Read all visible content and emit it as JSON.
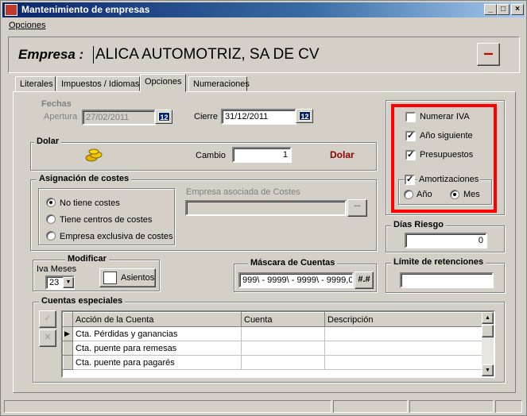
{
  "window": {
    "title": "Mantenimiento de empresas",
    "min": "_",
    "max": "□",
    "close": "×"
  },
  "menu": {
    "opciones": "Opciones"
  },
  "empresa": {
    "label": "Empresa :",
    "name": "ALICA AUTOMOTRIZ, SA DE CV",
    "minus_button": "–"
  },
  "tabs": [
    "Literales",
    "Impuestos / Idiomas",
    "Opciones",
    "Numeraciones"
  ],
  "fechas": {
    "title": "Fechas",
    "apertura_label": "Apertura",
    "apertura_value": "27/02/2011",
    "cierre_label": "Cierre",
    "cierre_value": "31/12/2011",
    "cal_icon_text": "12"
  },
  "dolar": {
    "title": "Dolar",
    "cambio_label": "Cambio",
    "cambio_value": "1",
    "dolar_label": "Dolar"
  },
  "costes": {
    "title": "Asignación de costes",
    "options": [
      "No tiene costes",
      "Tiene centros de costes",
      "Empresa exclusiva de costes"
    ],
    "selected": 0,
    "asociada_label": "Empresa asociada de Costes",
    "asociada_value": "",
    "lookup_icon_text": "ꟷ"
  },
  "modificar": {
    "title": "Modificar",
    "iva_meses_label": "Iva Meses",
    "iva_meses_value": "23",
    "asientos_label": "Asientos"
  },
  "mascara": {
    "title": "Máscara de Cuentas",
    "value": "999\\ - 9999\\ - 9999\\ - 9999,0",
    "button": "#.#"
  },
  "opciones": {
    "numerar_iva": "Numerar IVA",
    "numerar_iva_checked": false,
    "anio_siguiente": "Año siguiente",
    "anio_siguiente_checked": true,
    "presupuestos": "Presupuestos",
    "presupuestos_checked": true,
    "amortizaciones": "Amortizaciones",
    "amortizaciones_checked": true,
    "anio": "Año",
    "mes": "Mes",
    "periodo_selected": "Mes"
  },
  "dias_riesgo": {
    "title": "Días Riesgo",
    "value": "0"
  },
  "limite": {
    "title": "Límite de retenciones",
    "value": ""
  },
  "cuentas": {
    "title": "Cuentas especiales",
    "columns": [
      "Acción de la Cuenta",
      "Cuenta",
      "Descripción"
    ],
    "rows": [
      {
        "accion": "Cta. Pérdidas y ganancias",
        "cuenta": "",
        "descripcion": ""
      },
      {
        "accion": "Cta. puente para remesas",
        "cuenta": "",
        "descripcion": ""
      },
      {
        "accion": "Cta. puente para pagarés",
        "cuenta": "",
        "descripcion": ""
      }
    ]
  },
  "colors": {
    "title_start": "#0a246a",
    "highlight": "#ff0000",
    "dolar_text": "#8b0000"
  }
}
